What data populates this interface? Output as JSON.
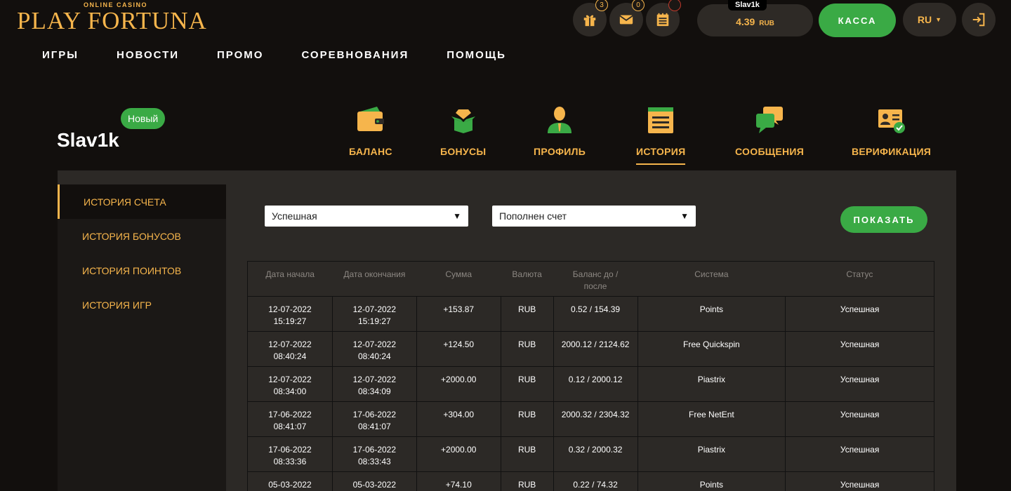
{
  "logo": {
    "subtitle": "ONLINE CASINO",
    "title": "PLAY FORTUNA"
  },
  "header": {
    "icons": [
      {
        "name": "gift-icon",
        "count": "3"
      },
      {
        "name": "mail-icon",
        "count": "0"
      },
      {
        "name": "notepad-icon",
        "count": ""
      }
    ],
    "user": "Slav1k",
    "balance": "4.39",
    "currency": "RUB",
    "kassa_label": "КАССА",
    "lang": "RU"
  },
  "topnav": [
    "ИГРЫ",
    "НОВОСТИ",
    "ПРОМО",
    "СОРЕВНОВАНИЯ",
    "ПОМОЩЬ"
  ],
  "profile": {
    "username": "Slav1k",
    "badge": "Новый",
    "tabs": [
      {
        "label": "БАЛАНС",
        "icon": "wallet-icon",
        "active": false
      },
      {
        "label": "БОНУСЫ",
        "icon": "gift-box-icon",
        "active": false
      },
      {
        "label": "ПРОФИЛЬ",
        "icon": "user-icon",
        "active": false
      },
      {
        "label": "ИСТОРИЯ",
        "icon": "notepad-icon",
        "active": true
      },
      {
        "label": "СООБЩЕНИЯ",
        "icon": "chat-icon",
        "active": false
      },
      {
        "label": "ВЕРИФИКАЦИЯ",
        "icon": "id-card-check-icon",
        "active": false
      }
    ]
  },
  "sidemenu": [
    "ИСТОРИЯ СЧЕТА",
    "ИСТОРИЯ БОНУСОВ",
    "ИСТОРИЯ ПОИНТОВ",
    "ИСТОРИЯ ИГР"
  ],
  "filters": {
    "status": "Успешная",
    "type": "Пополнен счет",
    "show_label": "ПОКАЗАТЬ"
  },
  "table": {
    "headers": [
      "Дата начала",
      "Дата окончания",
      "Сумма",
      "Валюта",
      "Баланс до / после",
      "Система",
      "Статус"
    ],
    "rows": [
      {
        "start_date": "12-07-2022",
        "start_time": "15:19:27",
        "end_date": "12-07-2022",
        "end_time": "15:19:27",
        "sum": "+153.87",
        "currency": "RUB",
        "balance": "0.52 / 154.39",
        "system": "Points",
        "status": "Успешная"
      },
      {
        "start_date": "12-07-2022",
        "start_time": "08:40:24",
        "end_date": "12-07-2022",
        "end_time": "08:40:24",
        "sum": "+124.50",
        "currency": "RUB",
        "balance": "2000.12 / 2124.62",
        "system": "Free Quickspin",
        "status": "Успешная"
      },
      {
        "start_date": "12-07-2022",
        "start_time": "08:34:00",
        "end_date": "12-07-2022",
        "end_time": "08:34:09",
        "sum": "+2000.00",
        "currency": "RUB",
        "balance": "0.12 / 2000.12",
        "system": "Piastrix",
        "status": "Успешная"
      },
      {
        "start_date": "17-06-2022",
        "start_time": "08:41:07",
        "end_date": "17-06-2022",
        "end_time": "08:41:07",
        "sum": "+304.00",
        "currency": "RUB",
        "balance": "2000.32 / 2304.32",
        "system": "Free NetEnt",
        "status": "Успешная"
      },
      {
        "start_date": "17-06-2022",
        "start_time": "08:33:36",
        "end_date": "17-06-2022",
        "end_time": "08:33:43",
        "sum": "+2000.00",
        "currency": "RUB",
        "balance": "0.32 / 2000.32",
        "system": "Piastrix",
        "status": "Успешная"
      },
      {
        "start_date": "05-03-2022",
        "start_time": "",
        "end_date": "05-03-2022",
        "end_time": "",
        "sum": "+74.10",
        "currency": "RUB",
        "balance": "0.22 / 74.32",
        "system": "Points",
        "status": "Успешная"
      }
    ]
  },
  "colors": {
    "accent": "#f6b54c",
    "green": "#3aaa45",
    "background": "#120f0d",
    "panel": "#2c2926"
  }
}
